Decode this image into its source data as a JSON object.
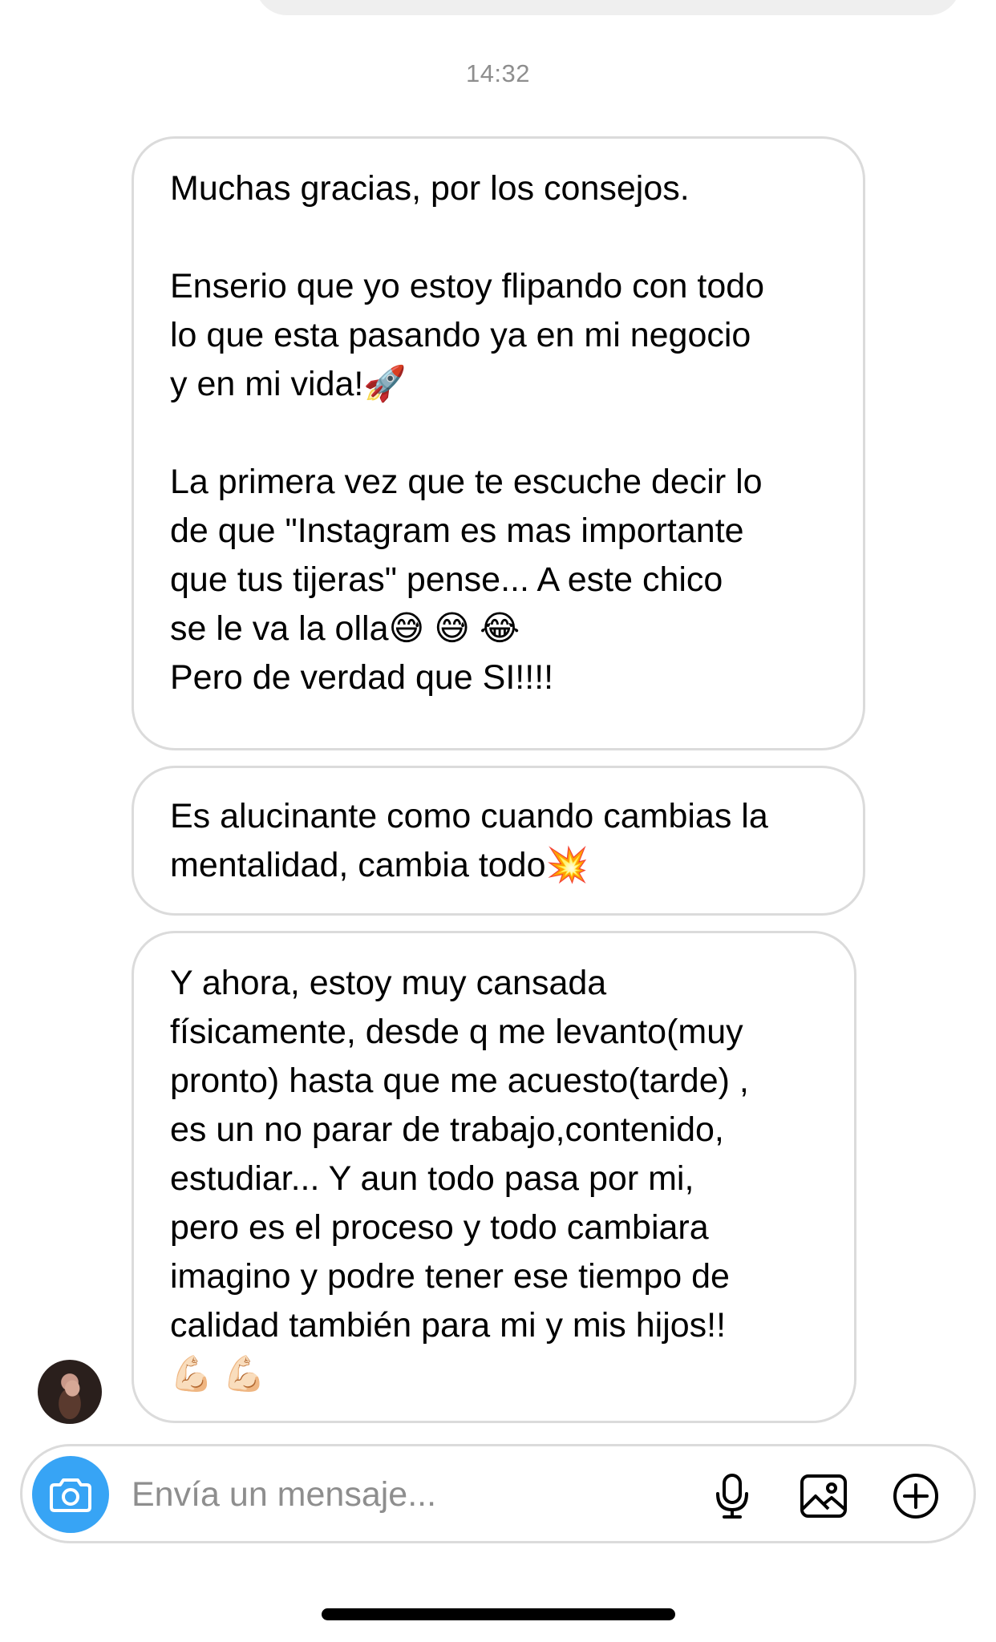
{
  "thread": {
    "timestamp": "14:32",
    "messages": [
      {
        "text": "Muchas gracias, por los consejos.\n\nEnserio que yo estoy flipando con todo\nlo que esta pasando ya en mi negocio\ny en mi vida!🚀\n\nLa primera vez que te escuche decir lo\nde que \"Instagram es mas importante\nque tus tijeras\" pense... A este chico\nse le va la olla😅 😅 😂\nPero de verdad que SI!!!!"
      },
      {
        "text": "Es alucinante como cuando cambias la\nmentalidad, cambia todo💥"
      },
      {
        "text": "Y ahora, estoy muy cansada\nfísicamente, desde q me levanto(muy\npronto) hasta que me acuesto(tarde) ,\nes un no parar de trabajo,contenido,\nestudiar... Y aun todo pasa por mi,\npero es el proceso y todo cambiara\nimagino y podre tener ese tiempo de\ncalidad también para mi y mis hijos!!\n💪🏻 💪🏻"
      }
    ]
  },
  "composer": {
    "placeholder": "Envía un mensaje...",
    "camera_icon": "camera-icon",
    "mic_icon": "microphone-icon",
    "gallery_icon": "gallery-icon",
    "add_icon": "plus-circle-icon",
    "accent_color": "#37a4f5"
  }
}
